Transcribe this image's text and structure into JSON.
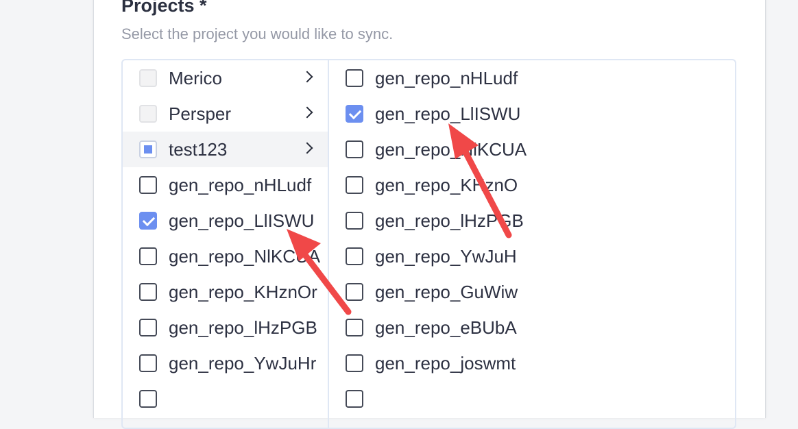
{
  "field": {
    "title": "Projects *",
    "hint": "Select the project you would like to sync."
  },
  "groups": [
    {
      "label": "Merico",
      "state": "disabled"
    },
    {
      "label": "Persper",
      "state": "disabled"
    },
    {
      "label": "test123",
      "state": "partial",
      "active": true
    }
  ],
  "left_repos": [
    {
      "label": "gen_repo_nHLudf",
      "checked": false
    },
    {
      "label": "gen_repo_LlISWU",
      "checked": true
    },
    {
      "label": "gen_repo_NlKCUA",
      "checked": false
    },
    {
      "label": "gen_repo_KHznOr",
      "checked": false
    },
    {
      "label": "gen_repo_lHzPGB",
      "checked": false
    },
    {
      "label": "gen_repo_YwJuHr",
      "checked": false
    }
  ],
  "right_repos": [
    {
      "label": "gen_repo_nHLudf",
      "checked": false
    },
    {
      "label": "gen_repo_LlISWU",
      "checked": true
    },
    {
      "label": "gen_repo_NlKCUA",
      "checked": false
    },
    {
      "label": "gen_repo_KHznO",
      "checked": false
    },
    {
      "label": "gen_repo_lHzPGB",
      "checked": false
    },
    {
      "label": "gen_repo_YwJuH",
      "checked": false
    },
    {
      "label": "gen_repo_GuWiw",
      "checked": false
    },
    {
      "label": "gen_repo_eBUbA",
      "checked": false
    },
    {
      "label": "gen_repo_joswmt",
      "checked": false
    }
  ],
  "colors": {
    "accent": "#6c8ff0",
    "annotation_arrow": "#f04848"
  }
}
